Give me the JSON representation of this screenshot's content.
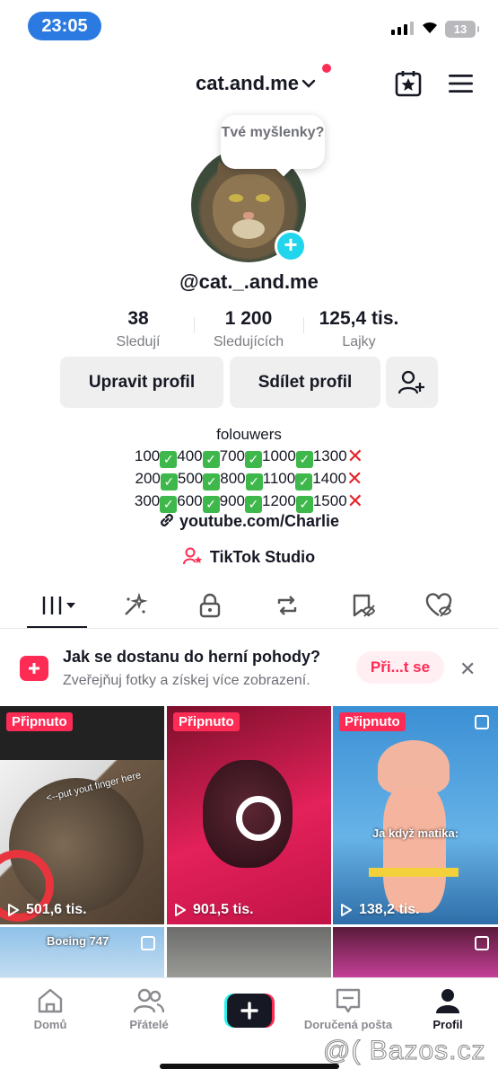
{
  "status_bar": {
    "time": "23:05",
    "battery": "13"
  },
  "header": {
    "account_name": "cat.and.me",
    "dropdown_icon": "chevron-down-icon",
    "calendar_icon": "calendar-star-icon",
    "menu_icon": "hamburger-menu-icon"
  },
  "profile": {
    "thought_bubble": "Tvé myšlenky?",
    "username": "@cat._.and.me",
    "stats": [
      {
        "value": "38",
        "label": "Sledují"
      },
      {
        "value": "1 200",
        "label": "Sledujících"
      },
      {
        "value": "125,4 tis.",
        "label": "Lajky"
      }
    ],
    "buttons": {
      "edit": "Upravit profil",
      "share": "Sdílet profil"
    },
    "bio_title": "folouwers",
    "bio_rows": [
      [
        "100",
        "400",
        "700",
        "1000",
        "1300"
      ],
      [
        "200",
        "500",
        "800",
        "1100",
        "1400"
      ],
      [
        "300",
        "600",
        "900",
        "1200",
        "1500"
      ]
    ],
    "link": "youtube.com/Charlie",
    "studio": "TikTok Studio"
  },
  "promo": {
    "title": "Jak se dostanu do herní pohody?",
    "subtitle": "Zveřejňuj fotky a získej více zobrazení.",
    "button": "Při...t se"
  },
  "videos": [
    {
      "pinned": "Připnuto",
      "views": "501,6 tis.",
      "caption": "<--put yout finger here"
    },
    {
      "pinned": "Připnuto",
      "views": "901,5 tis."
    },
    {
      "pinned": "Připnuto",
      "views": "138,2 tis.",
      "caption": "Ja když matika:"
    },
    {
      "caption": "Boeing 747"
    },
    {},
    {}
  ],
  "nav": {
    "home": "Domů",
    "friends": "Přátelé",
    "inbox": "Doručená pošta",
    "profile": "Profil"
  },
  "watermark": "@( Bazos.cz",
  "colors": {
    "brand": "#fe2c55",
    "accent": "#20d5ec",
    "time_pill": "#2a7ae2"
  }
}
